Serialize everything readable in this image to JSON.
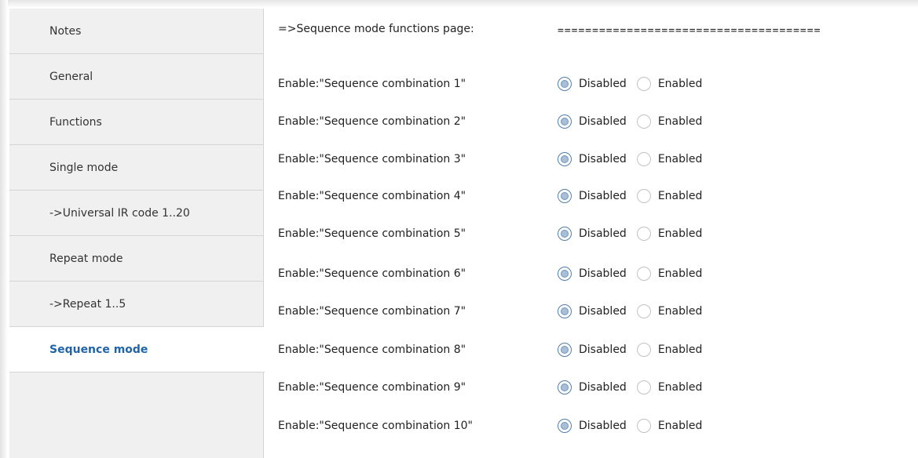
{
  "sidebar": {
    "items": [
      {
        "label": "Notes"
      },
      {
        "label": "General"
      },
      {
        "label": "Functions"
      },
      {
        "label": "Single mode"
      },
      {
        "label": "->Universal IR code 1..20"
      },
      {
        "label": "Repeat mode"
      },
      {
        "label": "->Repeat 1..5"
      },
      {
        "label": "Sequence mode"
      }
    ],
    "active": "Sequence mode"
  },
  "main": {
    "heading": {
      "label": "=>Sequence mode functions page:",
      "value": "======================================"
    },
    "rows": [
      {
        "label": "Enable:\"Sequence combination 1\"",
        "selected": "Disabled"
      },
      {
        "label": "Enable:\"Sequence combination 2\"",
        "selected": "Disabled"
      },
      {
        "label": "Enable:\"Sequence combination 3\"",
        "selected": "Disabled"
      },
      {
        "label": "Enable:\"Sequence combination 4\"",
        "selected": "Disabled"
      },
      {
        "label": "Enable:\"Sequence combination 5\"",
        "selected": "Disabled"
      },
      {
        "label": "Enable:\"Sequence combination 6\"",
        "selected": "Disabled"
      },
      {
        "label": "Enable:\"Sequence combination 7\"",
        "selected": "Disabled"
      },
      {
        "label": "Enable:\"Sequence combination 8\"",
        "selected": "Disabled"
      },
      {
        "label": "Enable:\"Sequence combination 9\"",
        "selected": "Disabled"
      },
      {
        "label": "Enable:\"Sequence combination 10\"",
        "selected": "Disabled"
      }
    ],
    "options": {
      "disabled": "Disabled",
      "enabled": "Enabled"
    }
  },
  "colors": {
    "active_text": "#1f64a8",
    "sidebar_bg": "#f0f0f0"
  }
}
